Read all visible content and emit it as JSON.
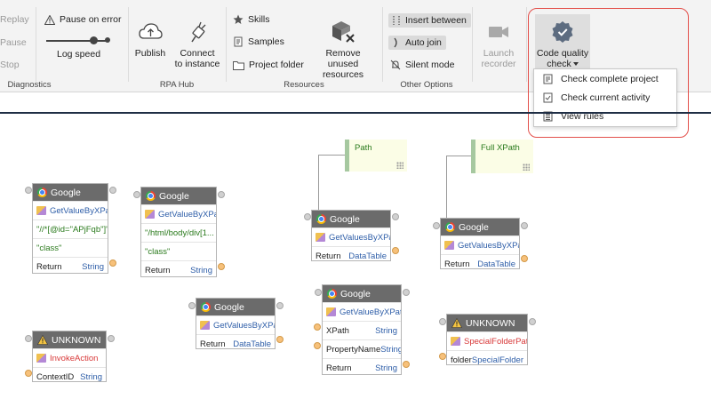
{
  "ribbon": {
    "diagnostics": {
      "replay": "Replay",
      "pause": "Pause",
      "stop": "Stop",
      "pause_on_error": "Pause on error",
      "log_speed": "Log speed",
      "label": "Diagnostics"
    },
    "rpa_hub": {
      "publish": "Publish",
      "connect_line1": "Connect",
      "connect_line2": "to instance",
      "label": "RPA Hub"
    },
    "resources": {
      "skills": "Skills",
      "samples": "Samples",
      "project_folder": "Project folder",
      "remove_line1": "Remove unused",
      "remove_line2": "resources",
      "label": "Resources"
    },
    "other": {
      "insert_between": "Insert between",
      "auto_join": "Auto join",
      "silent_mode": "Silent mode",
      "label": "Other Options"
    },
    "launch_recorder_line1": "Launch",
    "launch_recorder_line2": "recorder",
    "code_quality_line1": "Code quality",
    "code_quality_line2": "check",
    "code_quality_menu": {
      "check_project": "Check complete project",
      "check_activity": "Check current activity",
      "view_rules": "View rules"
    }
  },
  "canvas": {
    "comments": {
      "path": "Path",
      "full_xpath": "Full XPath"
    },
    "n1": {
      "title": "Google",
      "method": "GetValueByXPath",
      "arg1": "\"//*[@id=\"APjFqb\"]\"",
      "arg2": "\"class\"",
      "ret_label": "Return",
      "ret_type": "String"
    },
    "n2": {
      "title": "Google",
      "method": "GetValueByXPath",
      "arg1": "\"/html/body/div[1...",
      "arg2": "\"class\"",
      "ret_label": "Return",
      "ret_type": "String"
    },
    "n3": {
      "title": "Google",
      "method": "GetValuesByXPath",
      "ret_label": "Return",
      "ret_type": "DataTable"
    },
    "n4": {
      "title": "Google",
      "method": "GetValuesByXPath",
      "ret_label": "Return",
      "ret_type": "DataTable"
    },
    "n5": {
      "title": "Google",
      "method": "GetValuesByXPath",
      "ret_label": "Return",
      "ret_type": "DataTable"
    },
    "n6": {
      "title": "Google",
      "method": "GetValueByXPath",
      "p1_label": "XPath",
      "p1_type": "String",
      "p2_label": "PropertyName",
      "p2_type": "String",
      "ret_label": "Return",
      "ret_type": "String"
    },
    "n7": {
      "title": "UNKNOWN",
      "method": "InvokeAction",
      "p1_label": "ContextID",
      "p1_type": "String"
    },
    "n8": {
      "title": "UNKNOWN",
      "method": "SpecialFolderPath",
      "p1_label": "folder",
      "p1_type": "SpecialFolder"
    }
  }
}
